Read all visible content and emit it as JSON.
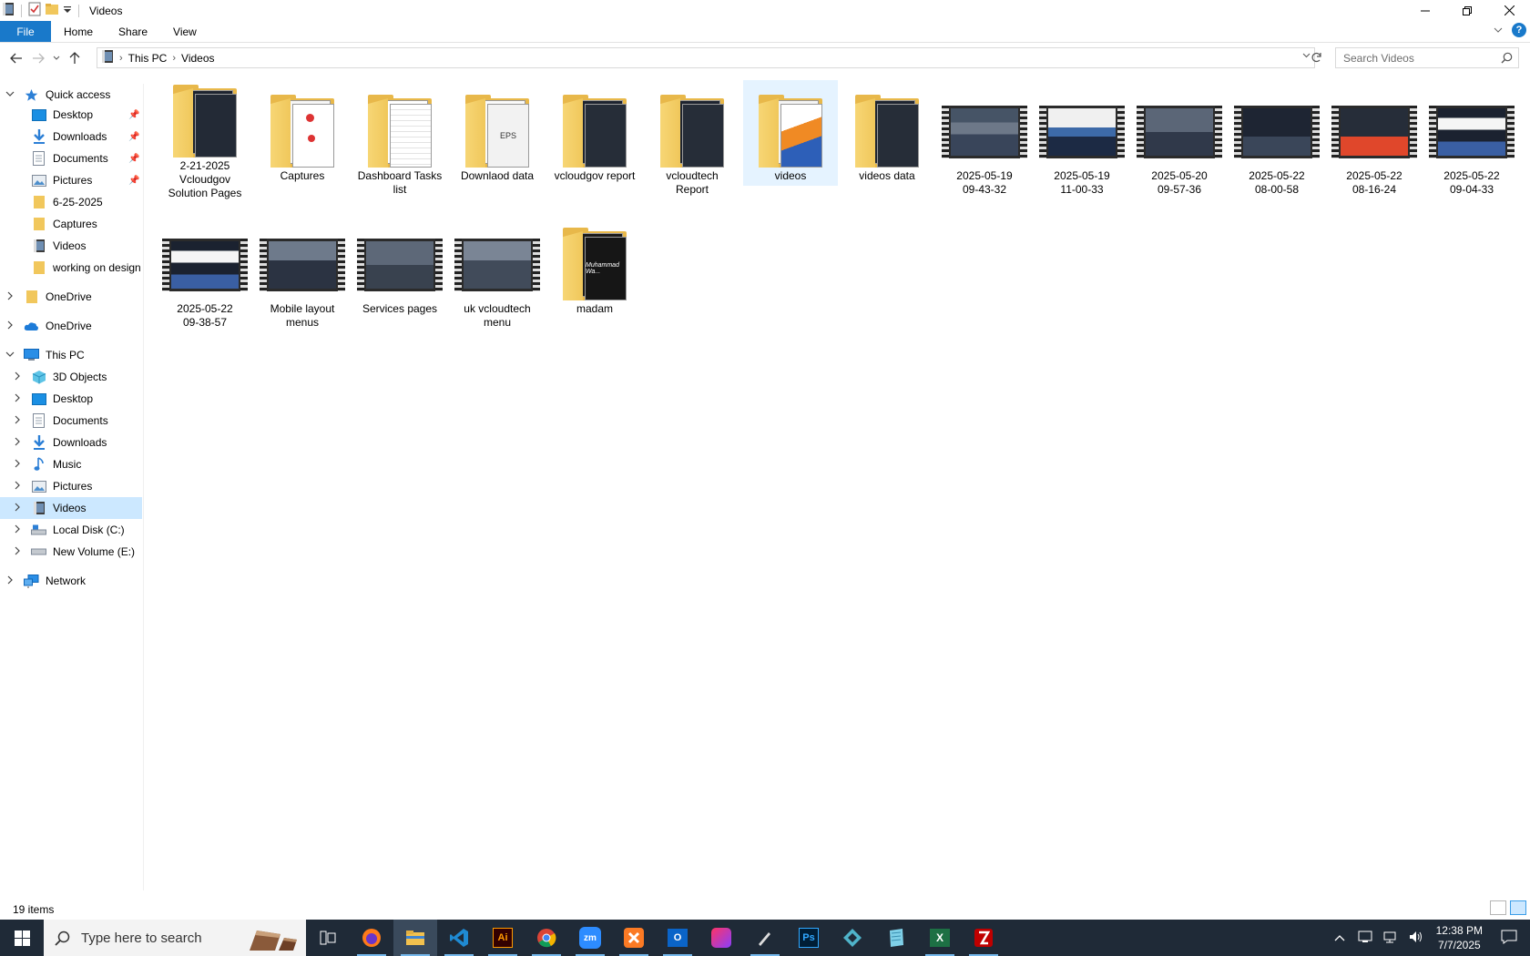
{
  "window": {
    "title": "Videos"
  },
  "ribbon": {
    "tabs": [
      "File",
      "Home",
      "Share",
      "View"
    ]
  },
  "address": {
    "crumbs": [
      "This PC",
      "Videos"
    ],
    "search_placeholder": "Search Videos"
  },
  "sidebar": {
    "quick_access": "Quick access",
    "quick_items": [
      "Desktop",
      "Downloads",
      "Documents",
      "Pictures",
      "6-25-2025",
      "Captures",
      "Videos",
      "working on design"
    ],
    "onedrive_1": "OneDrive",
    "onedrive_2": "OneDrive",
    "this_pc": "This PC",
    "pc_items": [
      "3D Objects",
      "Desktop",
      "Documents",
      "Downloads",
      "Music",
      "Pictures",
      "Videos",
      "Local Disk (C:)",
      "New Volume (E:)"
    ],
    "network": "Network"
  },
  "items": [
    {
      "name1": "2-21-2025",
      "name2": "Vcloudgov",
      "name3": "Solution Pages",
      "kind": "folder"
    },
    {
      "name1": "Captures",
      "name2": "",
      "name3": "",
      "kind": "folder"
    },
    {
      "name1": "Dashboard Tasks",
      "name2": "list",
      "name3": "",
      "kind": "folder"
    },
    {
      "name1": "Downlaod data",
      "name2": "",
      "name3": "",
      "kind": "folder"
    },
    {
      "name1": "vcloudgov report",
      "name2": "",
      "name3": "",
      "kind": "folder"
    },
    {
      "name1": "vcloudtech",
      "name2": "Report",
      "name3": "",
      "kind": "folder"
    },
    {
      "name1": "videos",
      "name2": "",
      "name3": "",
      "kind": "folder"
    },
    {
      "name1": "videos data",
      "name2": "",
      "name3": "",
      "kind": "folder"
    },
    {
      "name1": "2025-05-19",
      "name2": "09-43-32",
      "name3": "",
      "kind": "video"
    },
    {
      "name1": "2025-05-19",
      "name2": "11-00-33",
      "name3": "",
      "kind": "video"
    },
    {
      "name1": "2025-05-20",
      "name2": "09-57-36",
      "name3": "",
      "kind": "video"
    },
    {
      "name1": "2025-05-22",
      "name2": "08-00-58",
      "name3": "",
      "kind": "video"
    },
    {
      "name1": "2025-05-22",
      "name2": "08-16-24",
      "name3": "",
      "kind": "video"
    },
    {
      "name1": "2025-05-22",
      "name2": "09-04-33",
      "name3": "",
      "kind": "video"
    },
    {
      "name1": "2025-05-22",
      "name2": "09-38-57",
      "name3": "",
      "kind": "video"
    },
    {
      "name1": "Mobile layout",
      "name2": "menus",
      "name3": "",
      "kind": "video"
    },
    {
      "name1": "Services pages",
      "name2": "",
      "name3": "",
      "kind": "video"
    },
    {
      "name1": "uk vcloudtech",
      "name2": "menu",
      "name3": "",
      "kind": "video"
    },
    {
      "name1": "madam",
      "name2": "",
      "name3": "",
      "kind": "folder"
    }
  ],
  "madam_cover_text": "Muhammad Wa...",
  "eps_text": "EPS",
  "status": {
    "count": "19 items"
  },
  "taskbar": {
    "search_placeholder": "Type here to search",
    "apps": [
      "task-view",
      "firefox",
      "file-explorer",
      "vscode",
      "illustrator",
      "chrome",
      "zoom",
      "xampp",
      "outlook",
      "creative-cloud",
      "pen-tool",
      "photoshop",
      "app-cube",
      "notepad-app",
      "excel",
      "filezilla"
    ],
    "time": "12:38 PM",
    "date": "7/7/2025"
  },
  "colors": {
    "accent": "#1979ca",
    "selection": "#cce8ff",
    "folder": "#e8b84a",
    "taskbar": "#1f2a37"
  }
}
